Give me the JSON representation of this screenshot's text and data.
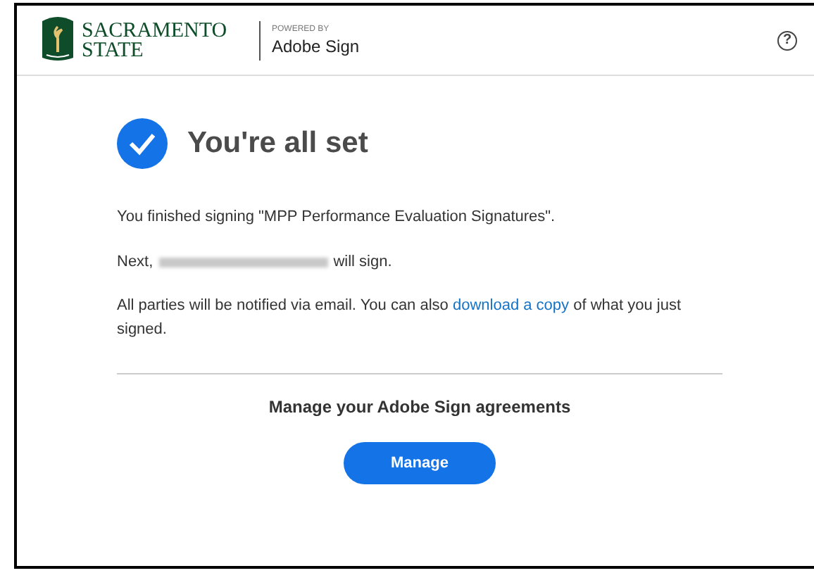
{
  "header": {
    "org_name_line1": "SACRAMENTO",
    "org_name_line2": "STATE",
    "powered_by": "POWERED BY",
    "product": "Adobe Sign",
    "help_icon": "?"
  },
  "confirmation": {
    "title": "You're all set",
    "finished": "You finished signing \"MPP Performance Evaluation Signatures\".",
    "next_prefix": "Next,",
    "next_suffix": "will sign.",
    "notice_before": "All parties will be notified via email. You can also",
    "notice_link": "download a copy",
    "notice_after": "of what you just signed."
  },
  "manage": {
    "heading": "Manage your Adobe Sign agreements",
    "button": "Manage"
  }
}
